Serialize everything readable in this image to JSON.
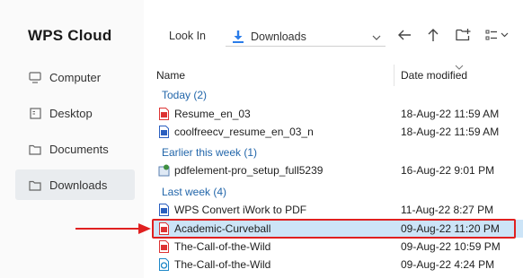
{
  "app": {
    "title": "WPS Cloud"
  },
  "sidebar": {
    "items": [
      {
        "label": "Computer",
        "icon": "monitor-icon"
      },
      {
        "label": "Desktop",
        "icon": "desktop-icon"
      },
      {
        "label": "Documents",
        "icon": "folder-icon"
      },
      {
        "label": "Downloads",
        "icon": "folder-icon",
        "active": true
      }
    ]
  },
  "toolbar": {
    "look_in_label": "Look In",
    "location": "Downloads",
    "buttons": [
      "back-arrow-icon",
      "up-arrow-icon",
      "new-folder-icon",
      "view-options-icon"
    ]
  },
  "list": {
    "columns": {
      "name": "Name",
      "date": "Date modified"
    },
    "groups": [
      {
        "label": "Today (2)",
        "files": [
          {
            "name": "Resume_en_03",
            "date": "18-Aug-22 11:59 AM",
            "type": "pdf"
          },
          {
            "name": "coolfreecv_resume_en_03_n",
            "date": "18-Aug-22 11:59 AM",
            "type": "word"
          }
        ]
      },
      {
        "label": "Earlier this week (1)",
        "files": [
          {
            "name": "pdfelement-pro_setup_full5239",
            "date": "16-Aug-22 9:01 PM",
            "type": "installer"
          }
        ]
      },
      {
        "label": "Last week (4)",
        "files": [
          {
            "name": "WPS Convert iWork to PDF",
            "date": "11-Aug-22 8:27 PM",
            "type": "word"
          },
          {
            "name": "Academic-Curveball",
            "date": "09-Aug-22 11:20 PM",
            "type": "pdf",
            "selected": true
          },
          {
            "name": "The-Call-of-the-Wild",
            "date": "09-Aug-22 10:59 PM",
            "type": "pdf"
          },
          {
            "name": "The-Call-of-the-Wild",
            "date": "09-Aug-22 4:24 PM",
            "type": "epub"
          }
        ]
      }
    ]
  },
  "colors": {
    "accent": "#2b7de9",
    "group": "#2266aa",
    "highlight": "#e02020",
    "selected_row": "#cce4f7"
  }
}
